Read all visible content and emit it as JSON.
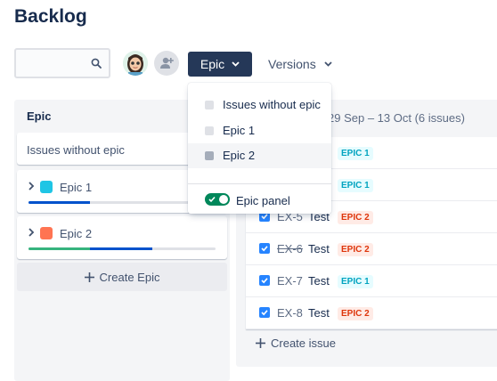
{
  "header": {
    "title": "Backlog"
  },
  "toolbar": {
    "search_placeholder": "",
    "epic_button": "Epic",
    "versions_button": "Versions"
  },
  "epic_panel": {
    "title": "Epic",
    "no_epic_label": "Issues without epic",
    "epics": [
      {
        "label": "Epic 1",
        "color": "#1fc5e5",
        "done": 0.0,
        "in_progress": 0.33
      },
      {
        "label": "Epic 2",
        "color": "#ff7452",
        "done": 0.33,
        "in_progress": 0.33
      }
    ],
    "create_label": "Create Epic"
  },
  "sprint": {
    "dates": "29 Sep – 13 Oct  (6 issues)",
    "issues": [
      {
        "key": "",
        "summary": "",
        "epic": "EPIC 1",
        "epic_class": "e1",
        "done": false
      },
      {
        "key": "",
        "summary": "",
        "epic": "EPIC 1",
        "epic_class": "e1",
        "done": false
      },
      {
        "key": "EX-5",
        "summary": "Test",
        "epic": "EPIC 2",
        "epic_class": "e2",
        "done": false
      },
      {
        "key": "EX-6",
        "summary": "Test",
        "epic": "EPIC 2",
        "epic_class": "e2",
        "done": true
      },
      {
        "key": "EX-7",
        "summary": "Test",
        "epic": "EPIC 1",
        "epic_class": "e1",
        "done": false
      },
      {
        "key": "EX-8",
        "summary": "Test",
        "epic": "EPIC 2",
        "epic_class": "e2",
        "done": false
      }
    ],
    "create_label": "Create issue"
  },
  "dropdown": {
    "items": [
      "Issues without epic",
      "Epic 1",
      "Epic 2"
    ],
    "selected_index": 2,
    "toggle_label": "Epic panel",
    "toggle_on": true
  },
  "colors": {
    "primary_dark": "#253858",
    "link_blue": "#2684ff",
    "toggle_green": "#00875a"
  }
}
